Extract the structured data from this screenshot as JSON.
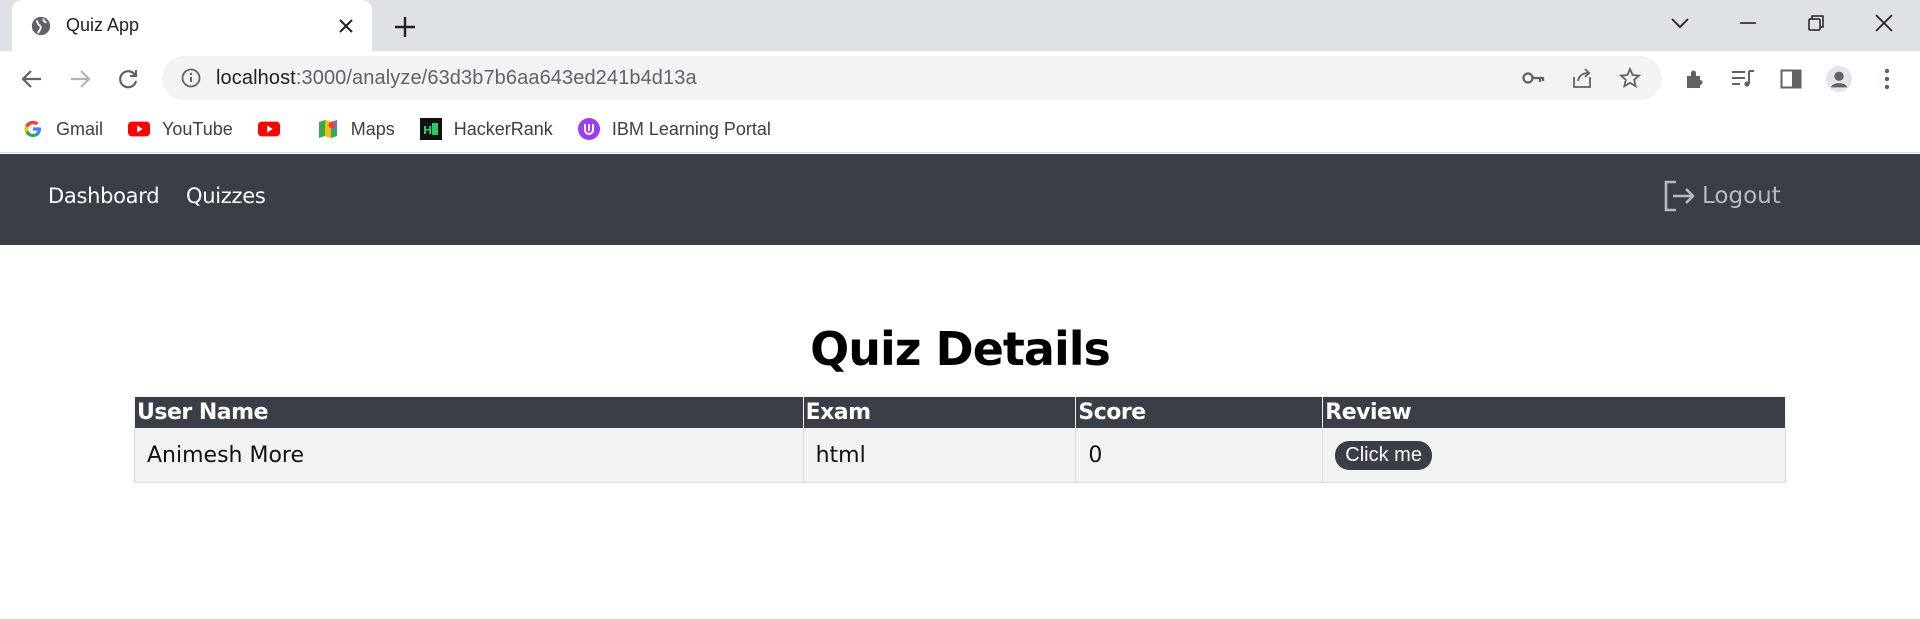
{
  "browser": {
    "tab_title": "Quiz App",
    "url_host": "localhost",
    "url_path": ":3000/analyze/63d3b7b6aa643ed241b4d13a",
    "bookmarks": [
      {
        "label": "Gmail",
        "icon": "google-icon"
      },
      {
        "label": "YouTube",
        "icon": "youtube-icon"
      },
      {
        "label": "",
        "icon": "youtube-icon"
      },
      {
        "label": "Maps",
        "icon": "maps-icon"
      },
      {
        "label": "HackerRank",
        "icon": "hackerrank-icon"
      },
      {
        "label": "IBM Learning Portal",
        "icon": "ibm-learning-icon"
      }
    ]
  },
  "navbar": {
    "links": [
      "Dashboard",
      "Quizzes"
    ],
    "logout_label": "Logout"
  },
  "main": {
    "title": "Quiz Details",
    "table": {
      "headers": [
        "User Name",
        "Exam",
        "Score",
        "Review"
      ],
      "rows": [
        {
          "user_name": "Animesh More",
          "exam": "html",
          "score": "0",
          "review_button": "Click me"
        }
      ]
    }
  },
  "colors": {
    "navbar_bg": "#3a3e47",
    "table_header_bg": "#3a3e47",
    "row_bg": "#f2f2f2",
    "logout_text": "#b7bac2"
  }
}
